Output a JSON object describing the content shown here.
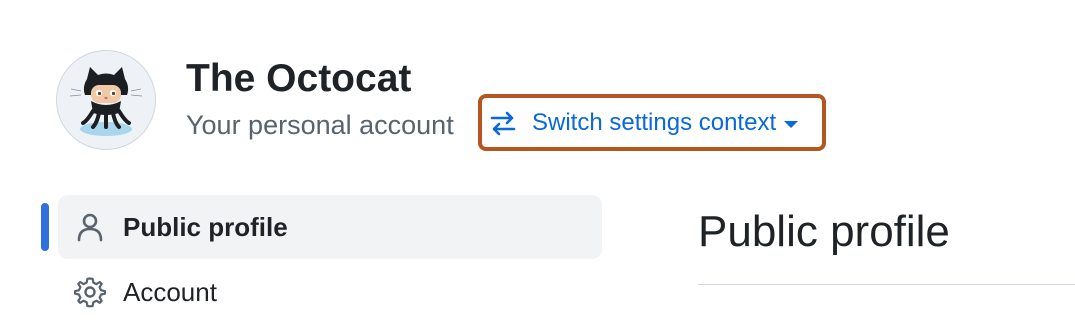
{
  "header": {
    "account_name": "The Octocat",
    "account_type": "Your personal account",
    "switch_label": "Switch settings context"
  },
  "sidebar": {
    "items": [
      {
        "label": "Public profile",
        "icon": "person-icon",
        "active": true
      },
      {
        "label": "Account",
        "icon": "gear-icon",
        "active": false
      }
    ]
  },
  "main": {
    "title": "Public profile"
  },
  "colors": {
    "link": "#0969da",
    "highlight_border": "#b5561f",
    "active_indicator": "#2f6fde",
    "active_bg": "#f2f3f5"
  }
}
